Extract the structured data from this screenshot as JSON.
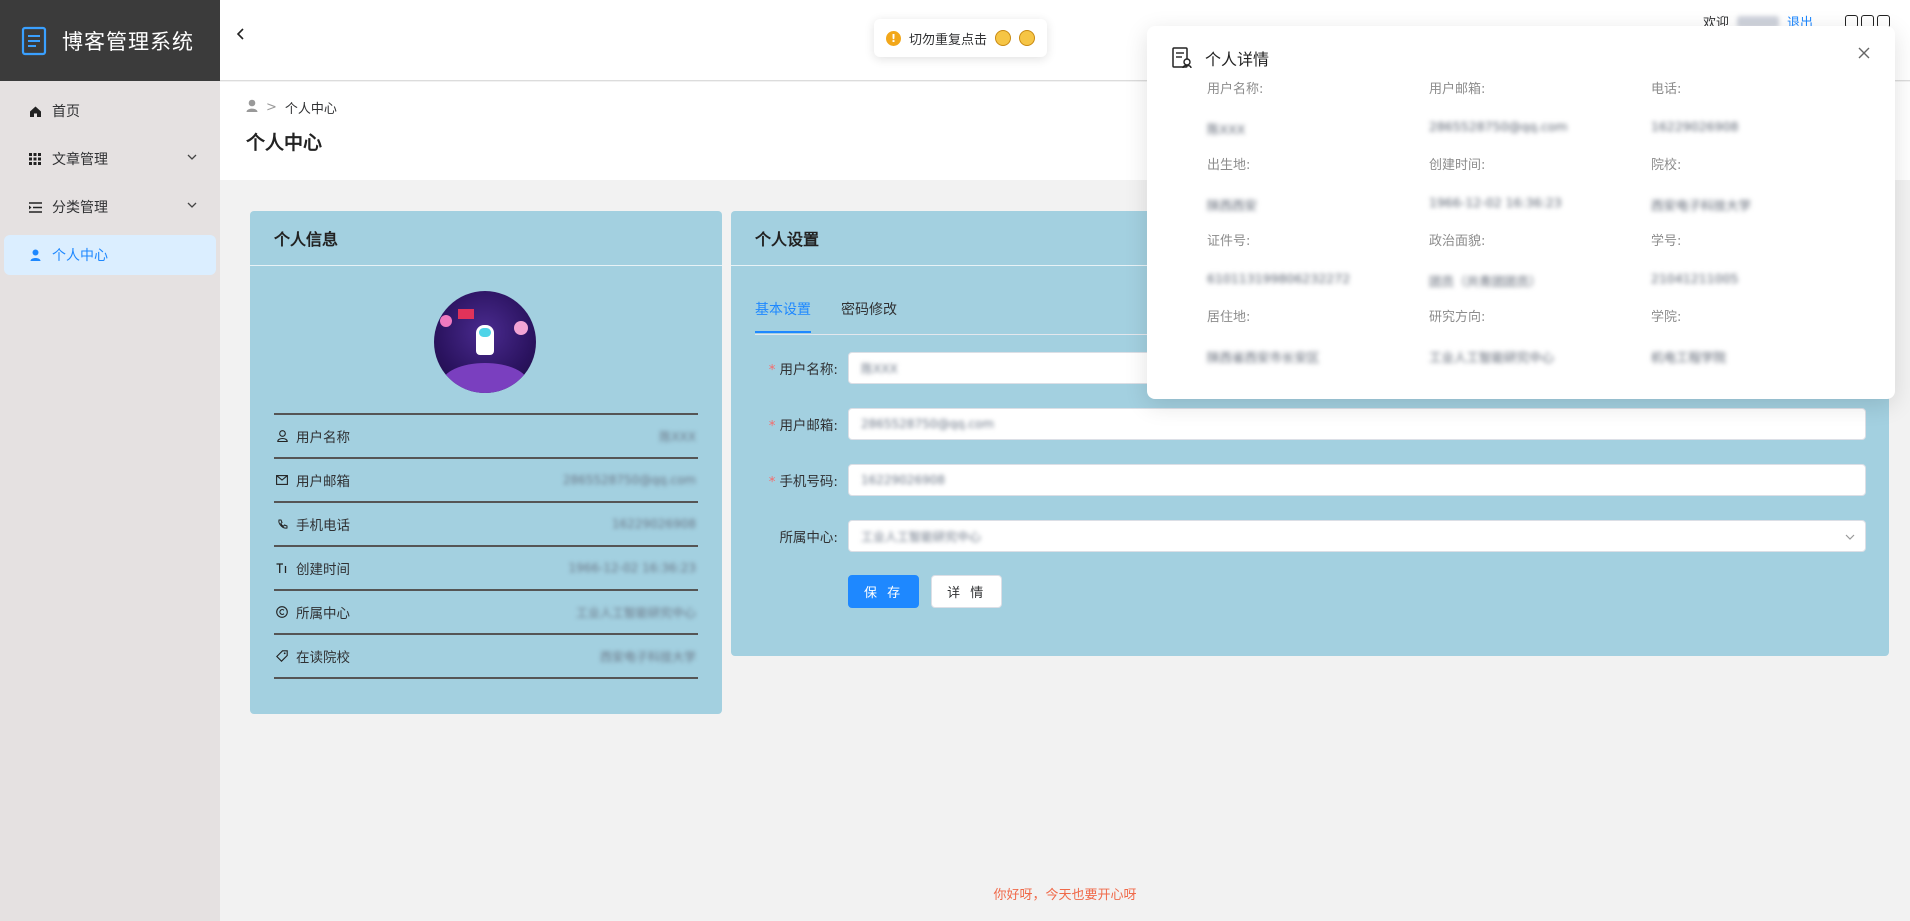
{
  "app": {
    "title": "博客管理系统"
  },
  "sidebar": {
    "items": [
      {
        "label": "首页",
        "icon": "home-icon"
      },
      {
        "label": "文章管理",
        "icon": "grid-icon",
        "expandable": true
      },
      {
        "label": "分类管理",
        "icon": "list-icon",
        "expandable": true
      },
      {
        "label": "个人中心",
        "icon": "user-icon",
        "active": true
      }
    ]
  },
  "header": {
    "welcome": "欢迎",
    "logout": "退出"
  },
  "toast": {
    "message": "切勿重复点击"
  },
  "breadcrumb": {
    "current": "个人中心"
  },
  "page": {
    "title": "个人中心"
  },
  "info_card": {
    "title": "个人信息",
    "rows": [
      {
        "label": "用户名称",
        "icon": "user-outline-icon",
        "value": "陈XXX"
      },
      {
        "label": "用户邮箱",
        "icon": "mail-icon",
        "value": "2865528750@qq.com"
      },
      {
        "label": "手机电话",
        "icon": "phone-icon",
        "value": "16229026908"
      },
      {
        "label": "创建时间",
        "icon": "text-icon",
        "value": "1966-12-02 16:36:23"
      },
      {
        "label": "所属中心",
        "icon": "copyright-icon",
        "value": "工业人工智能研究中心"
      },
      {
        "label": "在读院校",
        "icon": "tag-icon",
        "value": "西安电子科技大学"
      }
    ]
  },
  "settings_card": {
    "title": "个人设置",
    "tabs": [
      "基本设置",
      "密码修改"
    ],
    "fields": [
      {
        "label": "用户名称:",
        "required": true,
        "value": "陈XXX"
      },
      {
        "label": "用户邮箱:",
        "required": true,
        "value": "2865528750@qq.com"
      },
      {
        "label": "手机号码:",
        "required": true,
        "value": "16229026908"
      },
      {
        "label": "所属中心:",
        "required": false,
        "value": "工业人工智能研究中心",
        "type": "select"
      }
    ],
    "save_label": "保 存",
    "detail_label": "详 情"
  },
  "footer": {
    "text": "你好呀，今天也要开心呀"
  },
  "modal": {
    "title": "个人详情",
    "fields": [
      {
        "label": "用户名称:",
        "value": "陈XXX"
      },
      {
        "label": "用户邮箱:",
        "value": "2865528750@qq.com"
      },
      {
        "label": "电话:",
        "value": "16229026908"
      },
      {
        "label": "出生地:",
        "value": "陕西西安"
      },
      {
        "label": "创建时间:",
        "value": "1966-12-02 16:36:23"
      },
      {
        "label": "院校:",
        "value": "西安电子科技大学"
      },
      {
        "label": "证件号:",
        "value": "610113199806232272"
      },
      {
        "label": "政治面貌:",
        "value": "团员（共青团团员）"
      },
      {
        "label": "学号:",
        "value": "21041211005"
      },
      {
        "label": "居住地:",
        "value": "陕西省西安市长安区"
      },
      {
        "label": "研究方向:",
        "value": "工业人工智能研究中心"
      },
      {
        "label": "学院:",
        "value": "机电工程学院"
      }
    ]
  },
  "colors": {
    "accent": "#1e88ff",
    "card_bg": "#a3d0e0",
    "sidebar_bg": "#e5e1e1",
    "logo_bg": "#3b3b3b",
    "footer_text": "#f06a4a"
  }
}
